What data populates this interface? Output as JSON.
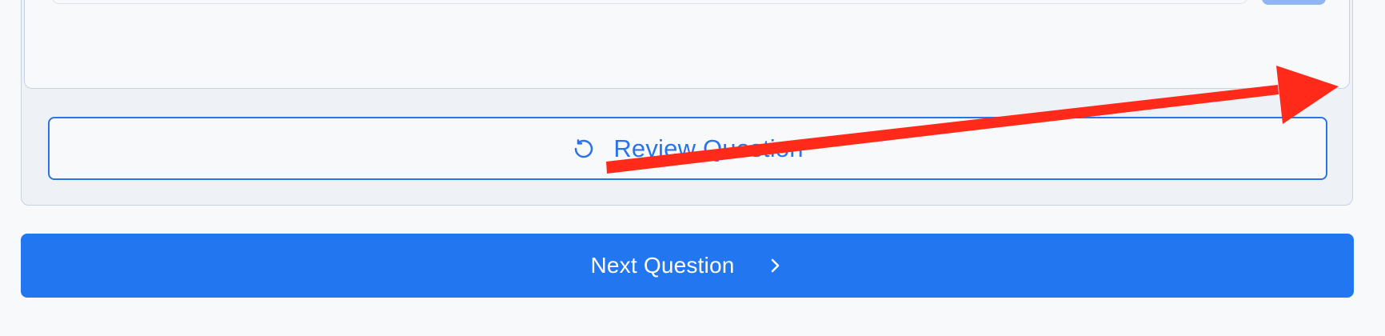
{
  "review_button": {
    "label": "Review Question",
    "icon": "rotate-ccw-icon"
  },
  "next_button": {
    "label": "Next Question",
    "icon": "chevron-right-icon"
  },
  "annotation": {
    "type": "arrow",
    "color": "#ff2a1a"
  },
  "colors": {
    "accent": "#2276f0",
    "outline_blue": "#2a73e8",
    "page_background": "#f8f9fb",
    "card_background": "#eef2f7",
    "border": "#c9d2df"
  }
}
